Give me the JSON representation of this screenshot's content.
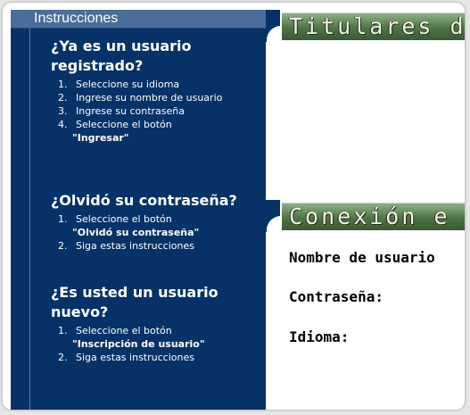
{
  "sidebar": {
    "header": "Instrucciones",
    "sections": [
      {
        "title_line1": "¿Ya es un usuario",
        "title_line2": "registrado?",
        "steps": [
          {
            "num": "1.",
            "text": "Seleccione su idioma"
          },
          {
            "num": "2.",
            "text": "Ingrese su nombre de usuario"
          },
          {
            "num": "3.",
            "text": "Ingrese su contraseña"
          },
          {
            "num": "4.",
            "text": "Seleccione el botón",
            "highlight": "\"Ingresar\""
          }
        ]
      },
      {
        "title_line1": "¿Olvidó su contraseña?",
        "steps": [
          {
            "num": "1.",
            "text": "Seleccione el botón",
            "highlight": "\"Olvidó su contraseña\""
          },
          {
            "num": "2.",
            "text": "Siga estas instrucciones"
          }
        ]
      },
      {
        "title_line1": "¿Es usted un usuario",
        "title_line2": "nuevo?",
        "steps": [
          {
            "num": "1.",
            "text": "Seleccione el botón",
            "highlight": "\"Inscripción de usuario\""
          },
          {
            "num": "2.",
            "text": "Siga estas instrucciones"
          }
        ]
      }
    ]
  },
  "main": {
    "headlines_title": "Titulares d",
    "login_title": "Conexión e",
    "username_label": "Nombre de usuario",
    "password_label": "Contraseña:",
    "language_label": "Idioma:"
  },
  "colors": {
    "sidebar_bg": "#063267",
    "header_bg": "#4b6d9c",
    "title_bar_green": "#4f7346"
  }
}
